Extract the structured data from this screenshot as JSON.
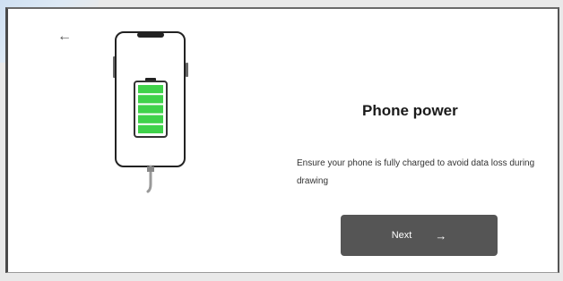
{
  "screen": {
    "title": "Phone power",
    "description": "Ensure your phone is fully charged to avoid data loss during drawing"
  },
  "buttons": {
    "back_glyph": "←",
    "next_label": "Next",
    "next_arrow": "→"
  },
  "battery": {
    "segments_filled": 5,
    "segments_total": 5
  },
  "colors": {
    "battery_green": "#3fd24a",
    "button_bg": "#555555",
    "accent_tint": "#cfe0f2"
  }
}
